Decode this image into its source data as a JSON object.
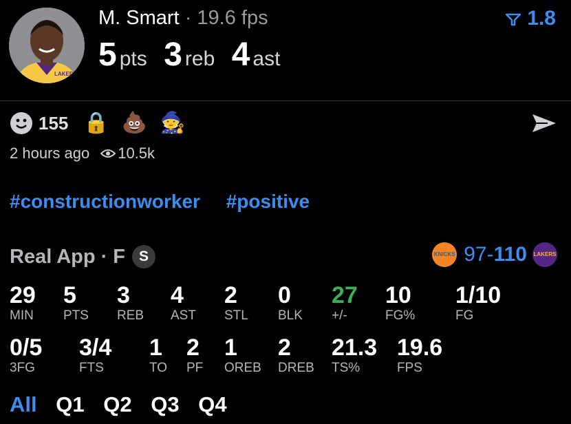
{
  "header": {
    "player_name": "M. Smart",
    "separator": "·",
    "fps_label": "19.6 fps",
    "pts": "5",
    "pts_unit": "pts",
    "reb": "3",
    "reb_unit": "reb",
    "ast": "4",
    "ast_unit": "ast",
    "rating": "1.8",
    "avatar_team": "LAKERS"
  },
  "reactions": {
    "count": "155",
    "emojis": [
      "🔒",
      "💩",
      "🧙"
    ]
  },
  "meta": {
    "time": "2 hours ago",
    "views": "10.5k"
  },
  "tags": [
    "#constructionworker",
    "#positive"
  ],
  "game": {
    "app": "Real App",
    "dot": "·",
    "status": "F",
    "badge": "S",
    "score_left": "97-",
    "score_right": "110",
    "left_team_abbr": "KNICKS",
    "right_team_abbr": "LAKERS"
  },
  "stats_row1": [
    {
      "value": "29",
      "label": "MIN"
    },
    {
      "value": "5",
      "label": "PTS"
    },
    {
      "value": "3",
      "label": "REB"
    },
    {
      "value": "4",
      "label": "AST"
    },
    {
      "value": "2",
      "label": "STL"
    },
    {
      "value": "0",
      "label": "BLK"
    },
    {
      "value": "27",
      "label": "+/-"
    },
    {
      "value": "10",
      "label": "FG%"
    },
    {
      "value": "1/10",
      "label": "FG"
    }
  ],
  "stats_row2": [
    {
      "value": "0/5",
      "label": "3FG"
    },
    {
      "value": "3/4",
      "label": "FTS"
    },
    {
      "value": "1",
      "label": "TO"
    },
    {
      "value": "2",
      "label": "PF"
    },
    {
      "value": "1",
      "label": "OREB"
    },
    {
      "value": "2",
      "label": "DREB"
    },
    {
      "value": "21.3",
      "label": "TS%"
    },
    {
      "value": "19.6",
      "label": "FPS"
    }
  ],
  "quarter_tabs": [
    "All",
    "Q1",
    "Q2",
    "Q3",
    "Q4"
  ],
  "colors": {
    "accent": "#3d8df0",
    "positive": "#3fae5a",
    "background": "#000000"
  }
}
